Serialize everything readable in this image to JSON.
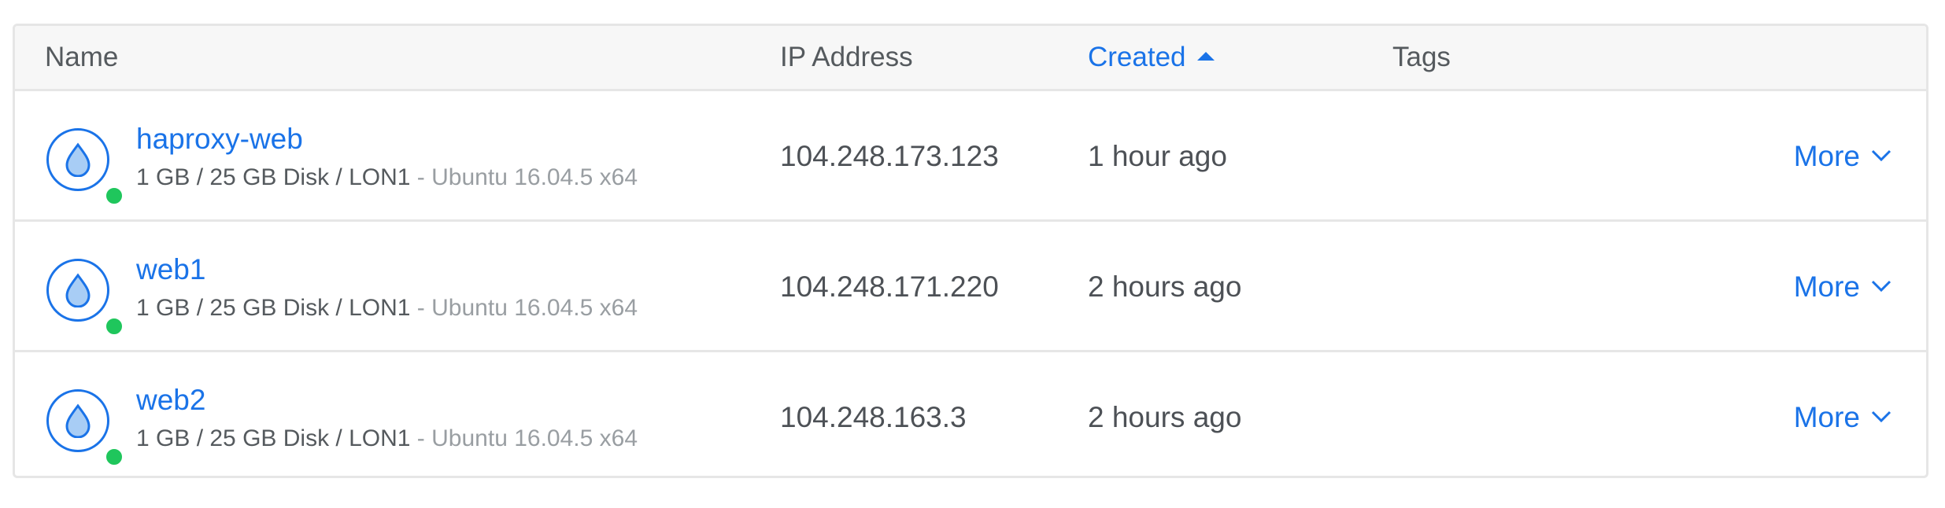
{
  "header": {
    "columns": {
      "name": "Name",
      "ip": "IP Address",
      "created": "Created",
      "tags": "Tags"
    },
    "sorted_column": "created",
    "sort_direction": "ascending"
  },
  "droplets": [
    {
      "name": "haproxy-web",
      "specs": "1 GB / 25 GB Disk / LON1",
      "separator": " - ",
      "os": "Ubuntu 16.04.5 x64",
      "ip": "104.248.173.123",
      "created": "1 hour ago",
      "more_label": "More",
      "status": "active"
    },
    {
      "name": "web1",
      "specs": "1 GB / 25 GB Disk / LON1",
      "separator": " - ",
      "os": "Ubuntu 16.04.5 x64",
      "ip": "104.248.171.220",
      "created": "2 hours ago",
      "more_label": "More",
      "status": "active"
    },
    {
      "name": "web2",
      "specs": "1 GB / 25 GB Disk / LON1",
      "separator": " - ",
      "os": "Ubuntu 16.04.5 x64",
      "ip": "104.248.163.3",
      "created": "2 hours ago",
      "more_label": "More",
      "status": "active"
    }
  ],
  "icons": {
    "droplet": "droplet-icon",
    "status": "status-dot",
    "sort": "sort-up-arrow-icon",
    "more": "chevron-down-icon"
  },
  "colors": {
    "link": "#1a73e8",
    "status_active": "#1fc65c",
    "text": "#4d5156",
    "muted": "#999ea2",
    "border": "#e6e6e6",
    "header_bg": "#f7f7f7"
  }
}
